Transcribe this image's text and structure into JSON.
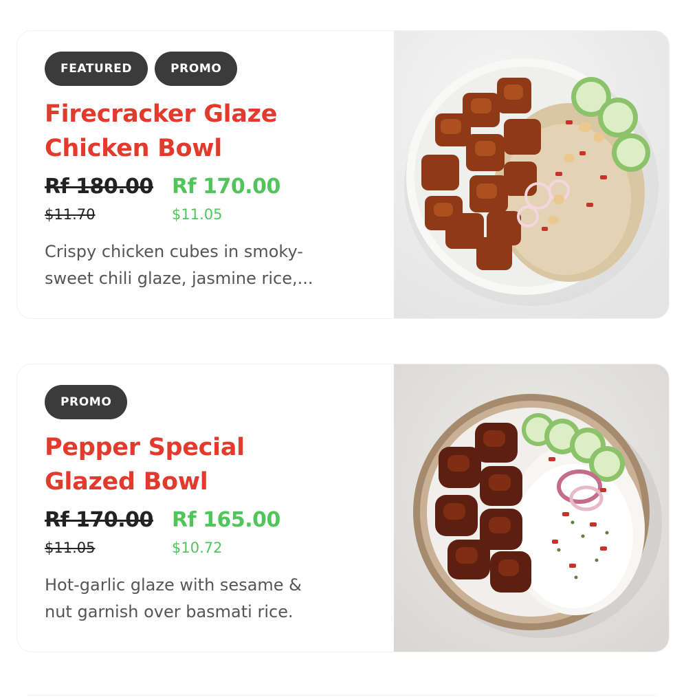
{
  "items": [
    {
      "badges": [
        "FEATURED",
        "PROMO"
      ],
      "title_line1": "Firecracker Glaze",
      "title_line2": "Chicken Bowl",
      "old_price": "Rf 180.00",
      "old_price_usd": "$11.70",
      "new_price": "Rf 170.00",
      "new_price_usd": "$11.05",
      "description_line1": "Crispy chicken cubes in smoky-",
      "description_line2": "sweet chili glaze, jasmine rice,..."
    },
    {
      "badges": [
        "PROMO"
      ],
      "title_line1": "Pepper Special",
      "title_line2": "Glazed Bowl",
      "old_price": "Rf 170.00",
      "old_price_usd": "$11.05",
      "new_price": "Rf 165.00",
      "new_price_usd": "$10.72",
      "description_line1": "Hot-garlic glaze with sesame &",
      "description_line2": "nut garnish over basmati rice."
    }
  ],
  "colors": {
    "title": "#e23a2c",
    "new_price": "#52c45c",
    "badge_bg": "#3b3b3b",
    "description": "#555555"
  }
}
